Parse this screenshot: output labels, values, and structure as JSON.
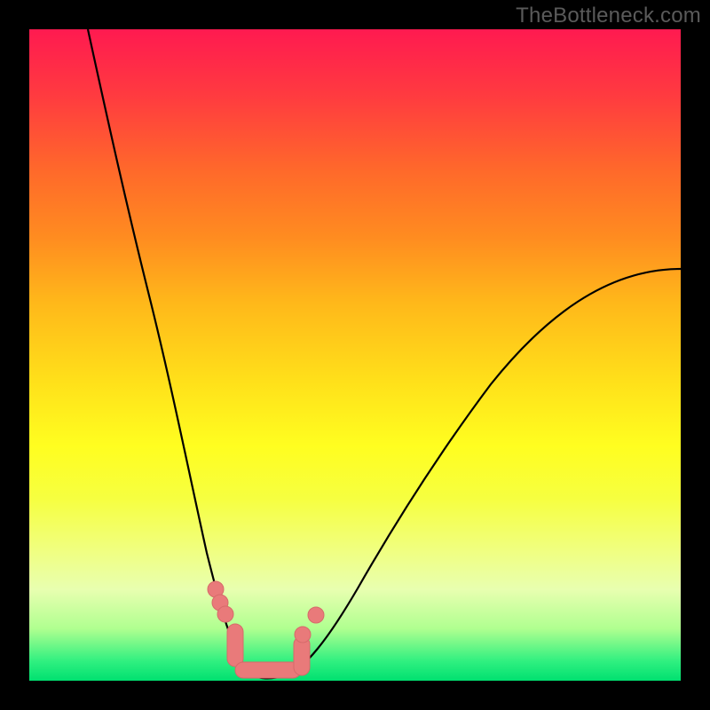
{
  "watermark": "TheBottleneck.com",
  "colors": {
    "curve": "#000000",
    "marker_fill": "#e97a7a",
    "marker_stroke": "#d66a6a",
    "background_top": "#ff1a50",
    "background_bottom": "#00e070",
    "frame": "#000000"
  },
  "chart_data": {
    "type": "line",
    "title": "",
    "xlabel": "",
    "ylabel": "",
    "xlim": [
      0,
      100
    ],
    "ylim": [
      0,
      100
    ],
    "grid": false,
    "legend": false,
    "note": "V-shaped bottleneck curve; y≈0 (green) is optimal, y≈100 (red) is worst. Minimum around x≈34–40. Left branch rises steeply to ~100 at x≈9; right branch rises to ~63 at x≈100.",
    "series": [
      {
        "name": "bottleneck-curve",
        "x": [
          9,
          12,
          15,
          18,
          21,
          24,
          27,
          30,
          33,
          35,
          37,
          40,
          44,
          50,
          56,
          62,
          68,
          74,
          80,
          86,
          92,
          100
        ],
        "y": [
          100,
          81,
          65,
          51,
          40,
          30,
          21,
          13,
          6,
          2,
          0,
          0,
          3,
          10,
          18,
          26,
          33,
          40,
          46,
          52,
          57,
          63
        ]
      }
    ],
    "markers": {
      "name": "highlighted-points",
      "x": [
        28.5,
        29.2,
        30.0,
        32.0,
        34.0,
        36.0,
        38.0,
        40.0,
        42.0,
        43.0,
        44.0
      ],
      "y": [
        14.0,
        12.0,
        10.5,
        6.0,
        2.0,
        0.5,
        0.5,
        0.5,
        2.5,
        5.0,
        8.5
      ]
    }
  }
}
